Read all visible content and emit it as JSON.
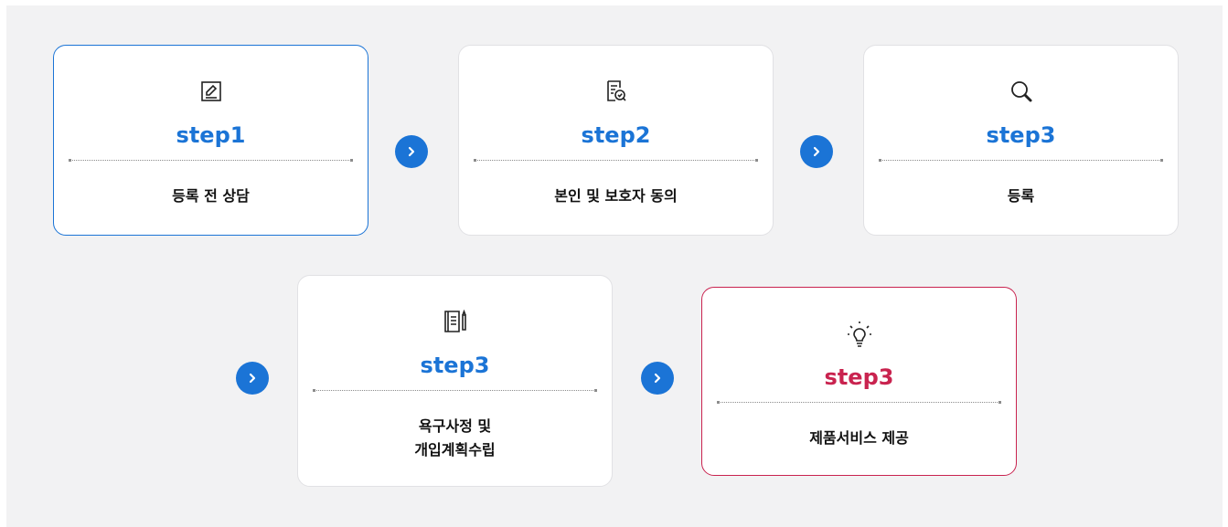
{
  "steps": [
    {
      "label": "step1",
      "desc": "등록 전 상담",
      "icon": "edit-icon"
    },
    {
      "label": "step2",
      "desc": "본인 및 보호자 동의",
      "icon": "document-check-icon"
    },
    {
      "label": "step3",
      "desc": "등록",
      "icon": "search-icon"
    },
    {
      "label": "step3",
      "desc_lines": [
        "욕구사정 및",
        "개입계획수립"
      ],
      "icon": "document-pen-icon"
    },
    {
      "label": "step3",
      "desc": "제품서비스 제공",
      "icon": "lightbulb-icon"
    }
  ],
  "colors": {
    "accent_blue": "#1b74d6",
    "accent_red": "#c9234f",
    "background": "#f2f2f3"
  },
  "arrow_icon": "chevron-right-icon"
}
